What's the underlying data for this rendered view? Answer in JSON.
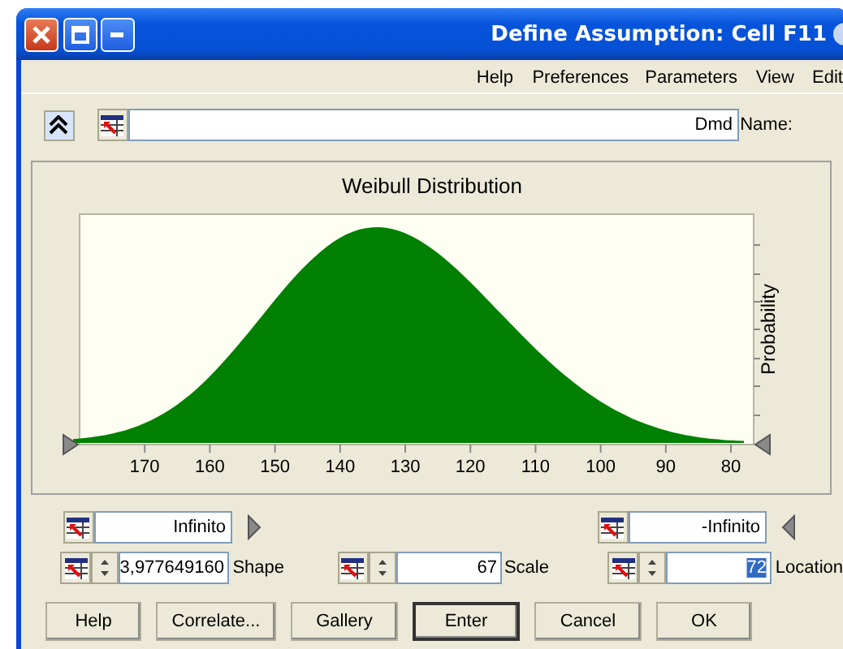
{
  "mirrored": true,
  "window": {
    "title": "Define Assumption: Cell F11"
  },
  "menu": [
    "Help",
    "Preferences",
    "Parameters",
    "View",
    "Edit"
  ],
  "name_field": {
    "label": "Name:",
    "value": "Dmd"
  },
  "chart": {
    "title": "Weibull Distribution",
    "ylabel": "Probability",
    "x_ticks": [
      "170",
      "160",
      "150",
      "140",
      "130",
      "120",
      "110",
      "100",
      "90",
      "80"
    ]
  },
  "bounds": [
    {
      "value": "Infinito"
    },
    {
      "value": "-Infinito"
    }
  ],
  "parameters": [
    {
      "label": "Shape",
      "value": "3,977649160",
      "selected": false
    },
    {
      "label": "Scale",
      "value": "67",
      "selected": false
    },
    {
      "label": "Location",
      "value": "72",
      "selected": true
    }
  ],
  "buttons": [
    {
      "label": "Help",
      "default": false
    },
    {
      "label": "Correlate...",
      "default": false
    },
    {
      "label": "Gallery",
      "default": false
    },
    {
      "label": "Enter",
      "default": true
    },
    {
      "label": "Cancel",
      "default": false
    },
    {
      "label": "OK",
      "default": false
    }
  ]
}
